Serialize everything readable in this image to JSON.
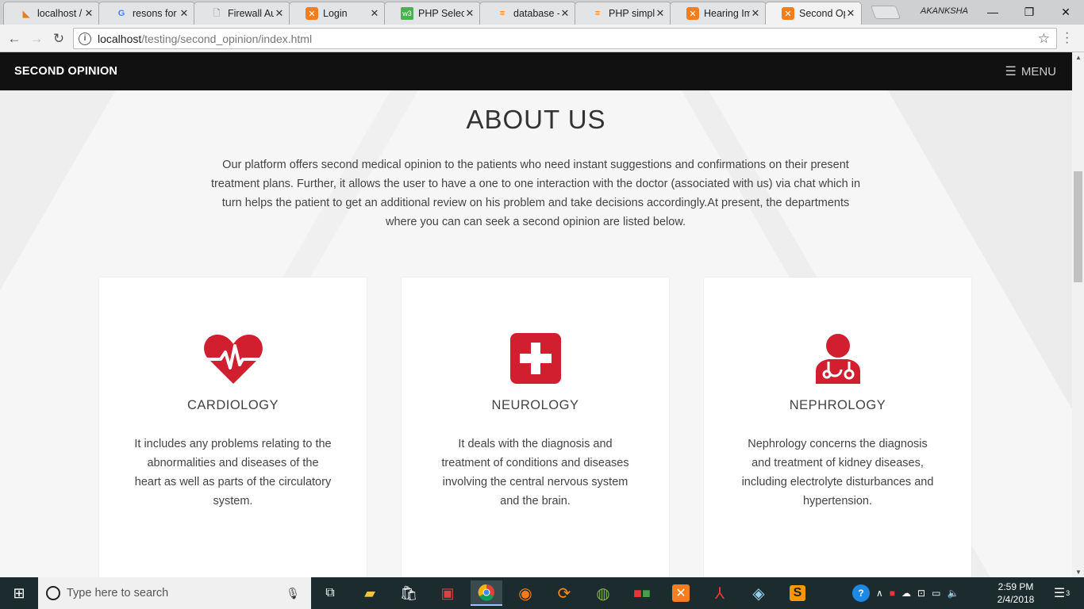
{
  "browser": {
    "tabs": [
      {
        "title": "localhost /",
        "icon": "phpmyadmin-icon"
      },
      {
        "title": "resons for f",
        "icon": "google-icon"
      },
      {
        "title": "Firewall Aut",
        "icon": "page-icon"
      },
      {
        "title": "Login",
        "icon": "xampp-icon"
      },
      {
        "title": "PHP Select",
        "icon": "w3-icon"
      },
      {
        "title": "database -",
        "icon": "stackoverflow-icon"
      },
      {
        "title": "PHP simple",
        "icon": "stackoverflow-icon"
      },
      {
        "title": "Hearing Im",
        "icon": "xampp-icon"
      },
      {
        "title": "Second Op",
        "icon": "xampp-icon"
      }
    ],
    "user_name": "AKANKSHA",
    "url_host": "localhost",
    "url_path": "/testing/second_opinion/index.html"
  },
  "navbar": {
    "brand": "SECOND OPINION",
    "menu_label": "MENU"
  },
  "about": {
    "title": "ABOUT US",
    "text": "Our platform offers second medical opinion to the patients who need instant suggestions and confirmations on their present treatment plans. Further, it allows the user to have a one to one interaction with the doctor (associated with us) via chat which in turn helps the patient to get an additional review on his problem and take decisions accordingly.At present, the departments where you can can seek a second opinion are listed below."
  },
  "departments": [
    {
      "title": "CARDIOLOGY",
      "icon": "heartbeat-icon",
      "desc": "It includes any problems relating to the abnormalities and diseases of the heart as well as parts of the circulatory system."
    },
    {
      "title": "NEUROLOGY",
      "icon": "medical-cross-icon",
      "desc": "It deals with the diagnosis and treatment of conditions and diseases involving the central nervous system and the brain."
    },
    {
      "title": "NEPHROLOGY",
      "icon": "doctor-icon",
      "desc": "Nephrology concerns the diagnosis and treatment of kidney diseases, including electrolyte disturbances and hypertension."
    }
  ],
  "colors": {
    "accent_red": "#d11f2f",
    "navbar_bg": "#111111",
    "taskbar_bg": "#1b2b2e"
  },
  "taskbar": {
    "search_placeholder": "Type here to search",
    "time": "2:59 PM",
    "date": "2/4/2018",
    "notification_count": "3"
  }
}
